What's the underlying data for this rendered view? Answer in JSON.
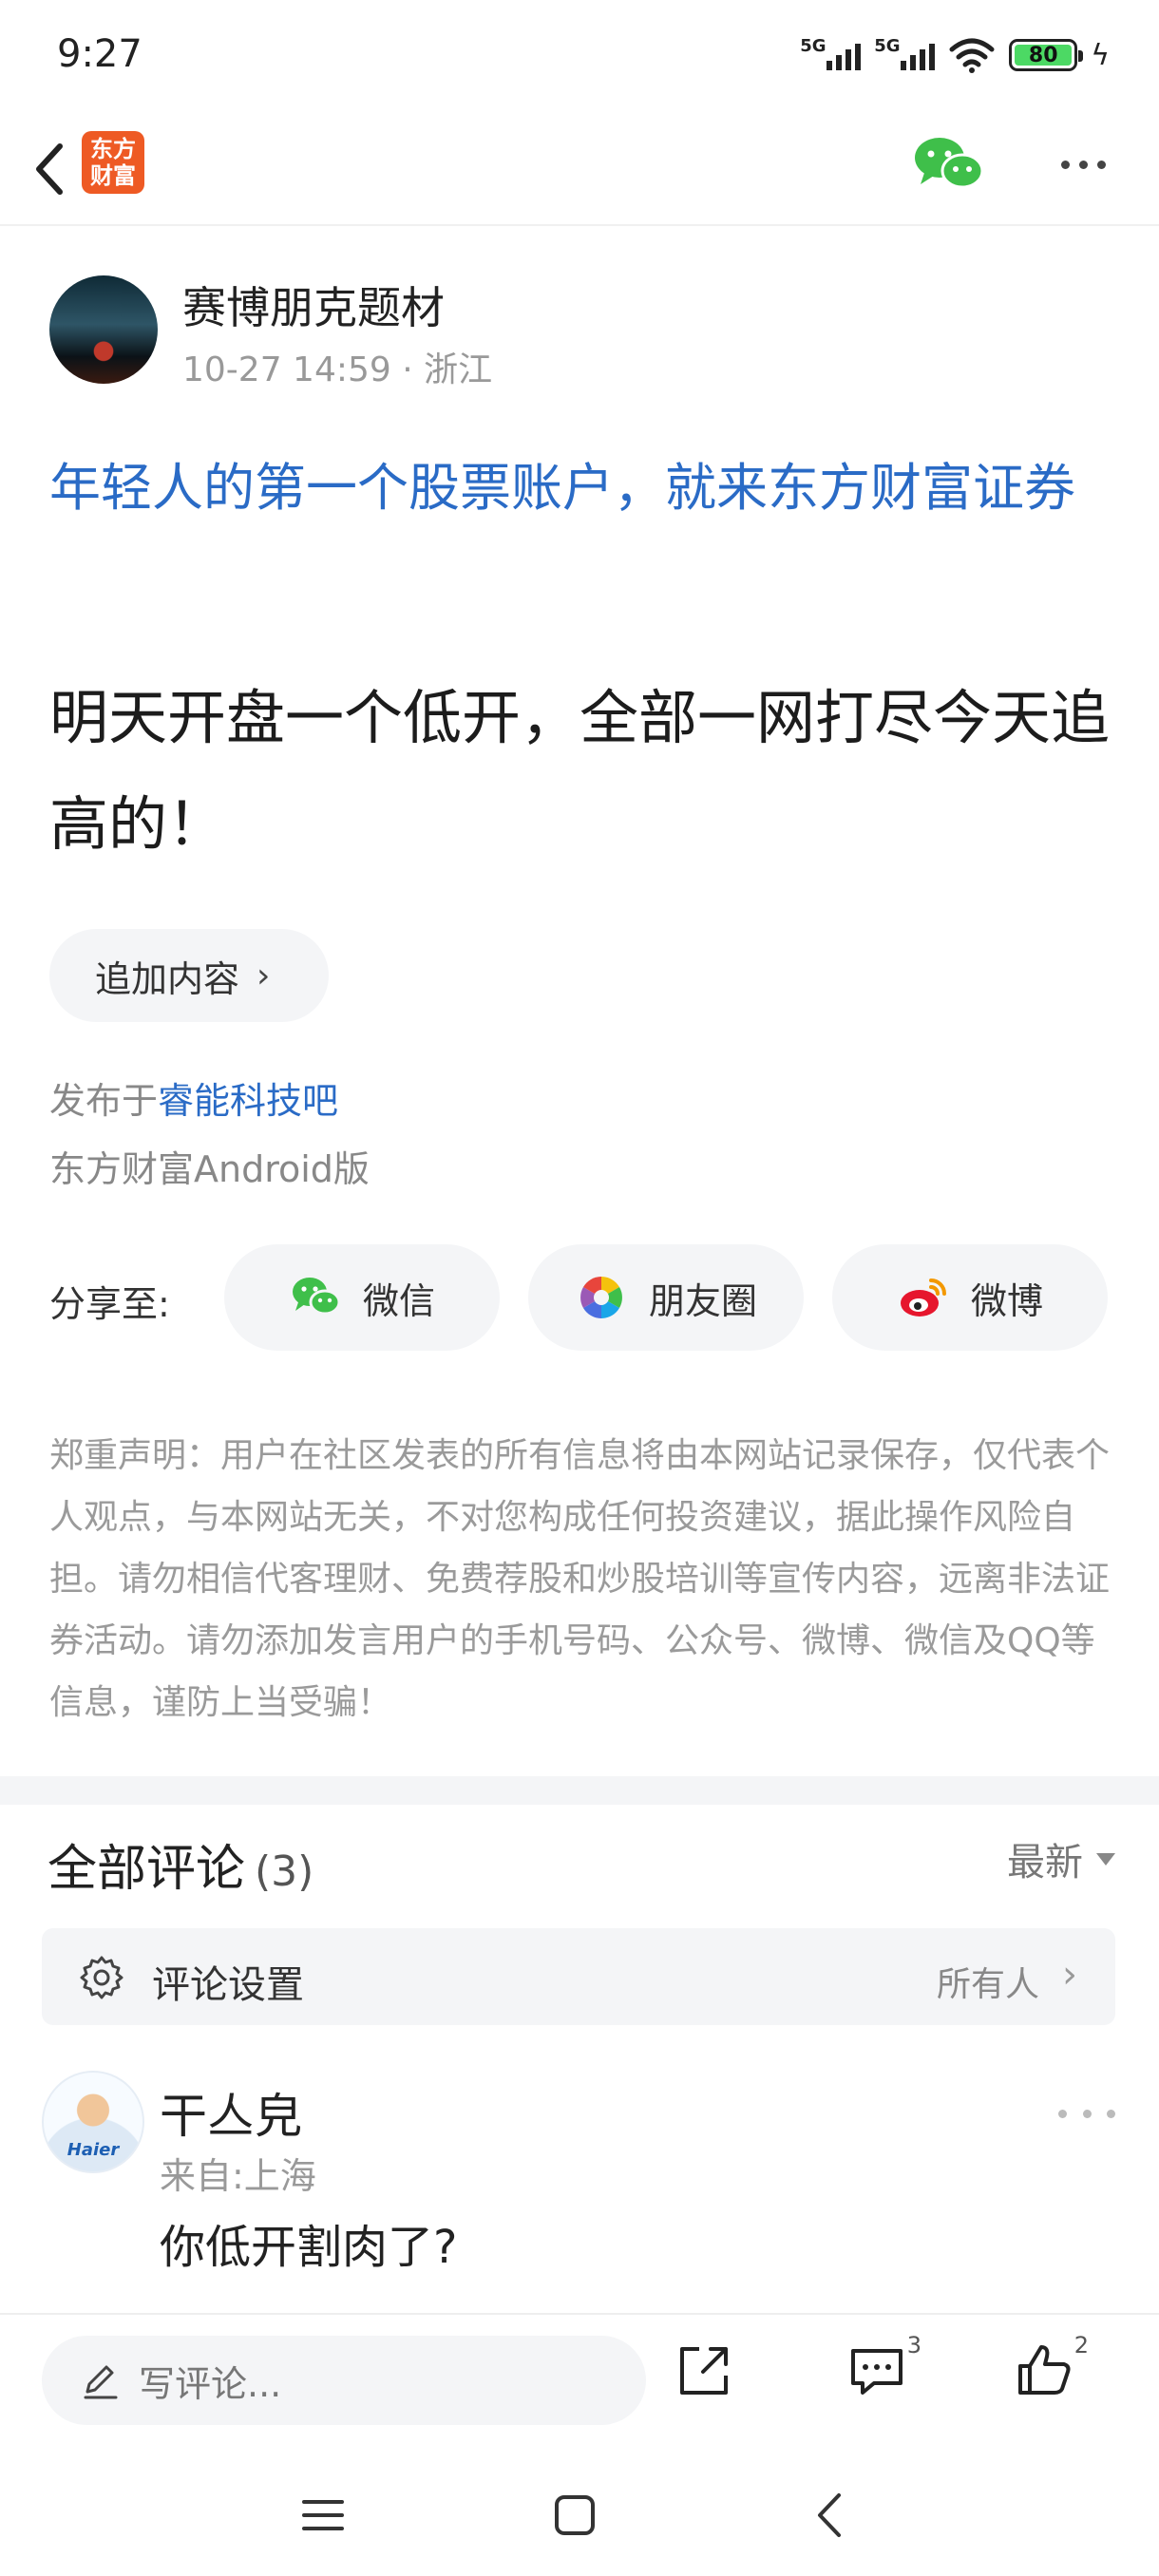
{
  "status_bar": {
    "time": "9:27",
    "network1": "5G",
    "network2": "5G",
    "battery": "80"
  },
  "nav": {
    "logo_line1": "东方",
    "logo_line2": "财富"
  },
  "post": {
    "author": "赛博朋克题材",
    "meta": "10-27 14:59 · 浙江",
    "promo": "年轻人的第一个股票账户，就来东方财富证券",
    "body": "明天开盘一个低开，全部一网打尽今天追高的！",
    "add_content": "追加内容",
    "published_prefix": "发布于",
    "published_bar": "睿能科技吧",
    "client": "东方财富Android版"
  },
  "share": {
    "label": "分享至:",
    "wechat": "微信",
    "moments": "朋友圈",
    "weibo": "微博"
  },
  "disclaimer": "郑重声明：用户在社区发表的所有信息将由本网站记录保存，仅代表个人观点，与本网站无关，不对您构成任何投资建议，据此操作风险自担。请勿相信代客理财、免费荐股和炒股培训等宣传内容，远离非法证券活动。请勿添加发言用户的手机号码、公众号、微博、微信及QQ等信息，谨防上当受骗！",
  "comments": {
    "title": "全部评论",
    "count": "(3)",
    "sort": "最新",
    "settings_label": "评论设置",
    "settings_value": "所有人",
    "items": [
      {
        "name": "干亼皃",
        "location": "来自:上海",
        "text": "你低开割肉了?",
        "avatar_brand": "Haier"
      }
    ]
  },
  "bottom_bar": {
    "write_placeholder": "写评论...",
    "comment_count": "3",
    "like_count": "2"
  },
  "colors": {
    "link": "#2a6bc6",
    "brand": "#ee5a24",
    "wechat": "#3fbf4a"
  }
}
